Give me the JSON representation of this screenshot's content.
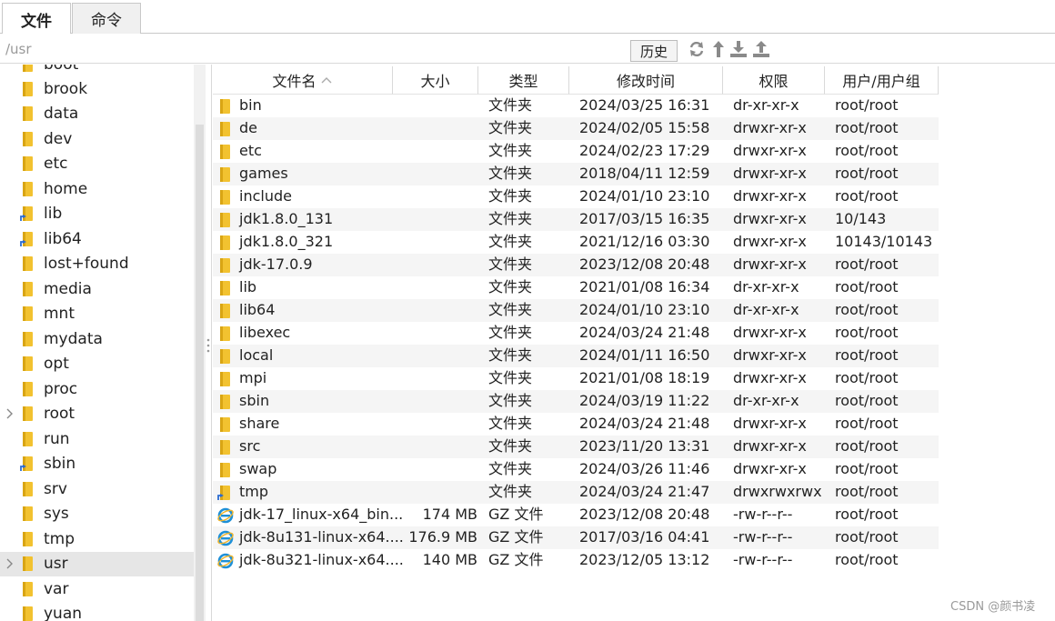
{
  "tabs": [
    {
      "label": "文件",
      "active": true
    },
    {
      "label": "命令",
      "active": false
    }
  ],
  "path": {
    "value": "/usr"
  },
  "toolbar": {
    "history_label": "历史",
    "icons": [
      "refresh-icon",
      "up-arrow-icon",
      "download-icon",
      "upload-icon"
    ]
  },
  "sidebar": {
    "items": [
      {
        "label": "boot",
        "type": "folder"
      },
      {
        "label": "brook",
        "type": "folder"
      },
      {
        "label": "data",
        "type": "folder"
      },
      {
        "label": "dev",
        "type": "folder"
      },
      {
        "label": "etc",
        "type": "folder"
      },
      {
        "label": "home",
        "type": "folder"
      },
      {
        "label": "lib",
        "type": "folder-link"
      },
      {
        "label": "lib64",
        "type": "folder-link"
      },
      {
        "label": "lost+found",
        "type": "folder"
      },
      {
        "label": "media",
        "type": "folder"
      },
      {
        "label": "mnt",
        "type": "folder"
      },
      {
        "label": "mydata",
        "type": "folder"
      },
      {
        "label": "opt",
        "type": "folder"
      },
      {
        "label": "proc",
        "type": "folder"
      },
      {
        "label": "root",
        "type": "folder",
        "expandable": true
      },
      {
        "label": "run",
        "type": "folder"
      },
      {
        "label": "sbin",
        "type": "folder-link"
      },
      {
        "label": "srv",
        "type": "folder"
      },
      {
        "label": "sys",
        "type": "folder"
      },
      {
        "label": "tmp",
        "type": "folder"
      },
      {
        "label": "usr",
        "type": "folder",
        "expandable": true,
        "selected": true
      },
      {
        "label": "var",
        "type": "folder"
      },
      {
        "label": "yuan",
        "type": "folder"
      }
    ]
  },
  "table": {
    "columns": [
      "文件名",
      "大小",
      "类型",
      "修改时间",
      "权限",
      "用户/用户组"
    ],
    "sort_column": "文件名",
    "rows": [
      {
        "name": "bin",
        "size": "",
        "type": "文件夹",
        "mtime": "2024/03/25 16:31",
        "perm": "dr-xr-xr-x",
        "owner": "root/root",
        "icon": "folder"
      },
      {
        "name": "de",
        "size": "",
        "type": "文件夹",
        "mtime": "2024/02/05 15:58",
        "perm": "drwxr-xr-x",
        "owner": "root/root",
        "icon": "folder"
      },
      {
        "name": "etc",
        "size": "",
        "type": "文件夹",
        "mtime": "2024/02/23 17:29",
        "perm": "drwxr-xr-x",
        "owner": "root/root",
        "icon": "folder"
      },
      {
        "name": "games",
        "size": "",
        "type": "文件夹",
        "mtime": "2018/04/11 12:59",
        "perm": "drwxr-xr-x",
        "owner": "root/root",
        "icon": "folder"
      },
      {
        "name": "include",
        "size": "",
        "type": "文件夹",
        "mtime": "2024/01/10 23:10",
        "perm": "drwxr-xr-x",
        "owner": "root/root",
        "icon": "folder"
      },
      {
        "name": "jdk1.8.0_131",
        "size": "",
        "type": "文件夹",
        "mtime": "2017/03/15 16:35",
        "perm": "drwxr-xr-x",
        "owner": "10/143",
        "icon": "folder"
      },
      {
        "name": "jdk1.8.0_321",
        "size": "",
        "type": "文件夹",
        "mtime": "2021/12/16 03:30",
        "perm": "drwxr-xr-x",
        "owner": "10143/10143",
        "icon": "folder"
      },
      {
        "name": "jdk-17.0.9",
        "size": "",
        "type": "文件夹",
        "mtime": "2023/12/08 20:48",
        "perm": "drwxr-xr-x",
        "owner": "root/root",
        "icon": "folder"
      },
      {
        "name": "lib",
        "size": "",
        "type": "文件夹",
        "mtime": "2021/01/08 16:34",
        "perm": "dr-xr-xr-x",
        "owner": "root/root",
        "icon": "folder"
      },
      {
        "name": "lib64",
        "size": "",
        "type": "文件夹",
        "mtime": "2024/01/10 23:10",
        "perm": "dr-xr-xr-x",
        "owner": "root/root",
        "icon": "folder"
      },
      {
        "name": "libexec",
        "size": "",
        "type": "文件夹",
        "mtime": "2024/03/24 21:48",
        "perm": "drwxr-xr-x",
        "owner": "root/root",
        "icon": "folder"
      },
      {
        "name": "local",
        "size": "",
        "type": "文件夹",
        "mtime": "2024/01/11 16:50",
        "perm": "drwxr-xr-x",
        "owner": "root/root",
        "icon": "folder"
      },
      {
        "name": "mpi",
        "size": "",
        "type": "文件夹",
        "mtime": "2021/01/08 18:19",
        "perm": "drwxr-xr-x",
        "owner": "root/root",
        "icon": "folder"
      },
      {
        "name": "sbin",
        "size": "",
        "type": "文件夹",
        "mtime": "2024/03/19 11:22",
        "perm": "dr-xr-xr-x",
        "owner": "root/root",
        "icon": "folder"
      },
      {
        "name": "share",
        "size": "",
        "type": "文件夹",
        "mtime": "2024/03/24 21:48",
        "perm": "drwxr-xr-x",
        "owner": "root/root",
        "icon": "folder"
      },
      {
        "name": "src",
        "size": "",
        "type": "文件夹",
        "mtime": "2023/11/20 13:31",
        "perm": "drwxr-xr-x",
        "owner": "root/root",
        "icon": "folder"
      },
      {
        "name": "swap",
        "size": "",
        "type": "文件夹",
        "mtime": "2024/03/26 11:46",
        "perm": "drwxr-xr-x",
        "owner": "root/root",
        "icon": "folder"
      },
      {
        "name": "tmp",
        "size": "",
        "type": "文件夹",
        "mtime": "2024/03/24 21:47",
        "perm": "drwxrwxrwx",
        "owner": "root/root",
        "icon": "folder-link"
      },
      {
        "name": "jdk-17_linux-x64_bin...",
        "size": "174 MB",
        "type": "GZ 文件",
        "mtime": "2023/12/08 20:48",
        "perm": "-rw-r--r--",
        "owner": "root/root",
        "icon": "ie-file"
      },
      {
        "name": "jdk-8u131-linux-x64....",
        "size": "176.9 MB",
        "type": "GZ 文件",
        "mtime": "2017/03/16 04:41",
        "perm": "-rw-r--r--",
        "owner": "root/root",
        "icon": "ie-file"
      },
      {
        "name": "jdk-8u321-linux-x64....",
        "size": "140 MB",
        "type": "GZ 文件",
        "mtime": "2023/12/05 13:12",
        "perm": "-rw-r--r--",
        "owner": "root/root",
        "icon": "ie-file"
      }
    ]
  },
  "watermark": "CSDN @颜书凌",
  "colors": {
    "folder": "#f2c230",
    "folder_dark": "#d9a514",
    "ie_blue": "#1e90d8",
    "selected": "#e6e6e6",
    "alt_row": "#f5f5f5"
  }
}
